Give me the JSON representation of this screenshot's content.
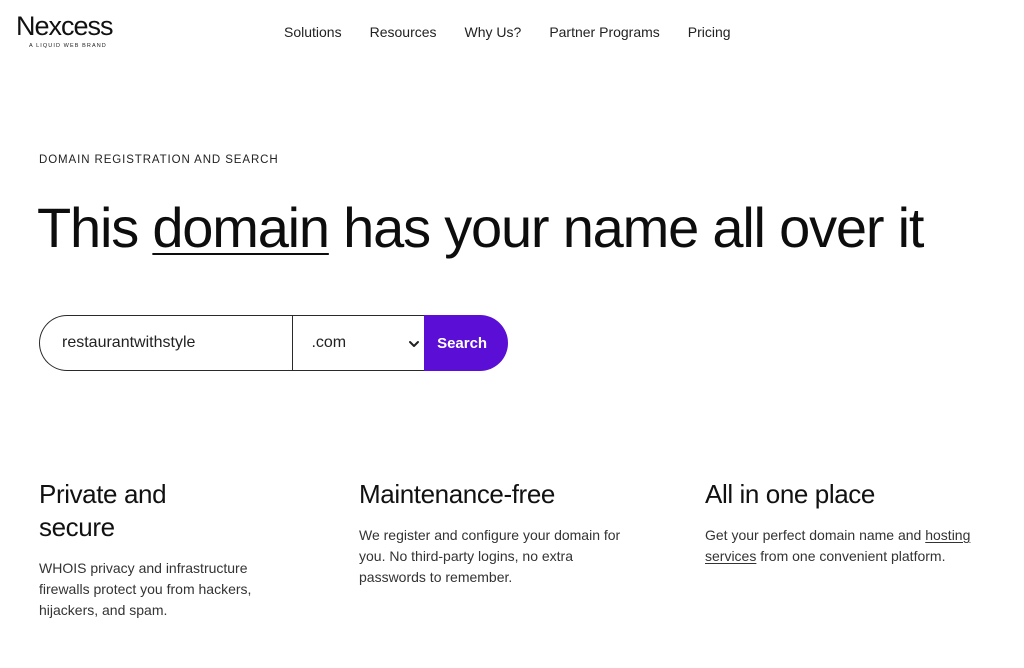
{
  "logo": {
    "wordmark": "Nexcess",
    "tagline": "A LIQUID WEB BRAND"
  },
  "nav": {
    "items": [
      {
        "label": "Solutions"
      },
      {
        "label": "Resources"
      },
      {
        "label": "Why Us?"
      },
      {
        "label": "Partner Programs"
      },
      {
        "label": "Pricing"
      }
    ]
  },
  "hero": {
    "eyebrow": "DOMAIN REGISTRATION AND SEARCH",
    "headline_before": "This ",
    "headline_link": "domain",
    "headline_after": " has your name all over it"
  },
  "search": {
    "input_value": "restaurantwithstyle",
    "tld_selected": ".com",
    "button_label": "Search"
  },
  "features": [
    {
      "title_line1": "Private and",
      "title_line2": "secure",
      "text": "WHOIS privacy and infrastructure firewalls protect you from hackers, hijackers, and spam."
    },
    {
      "title": "Maintenance-free",
      "text": "We register and configure your domain for you. No third-party logins, no extra passwords to remember."
    },
    {
      "title": "All in one place",
      "text_before": "Get your perfect domain name and ",
      "link": "hosting services",
      "text_after": " from one convenient platform."
    }
  ],
  "colors": {
    "accent": "#5b0fd6",
    "text": "#111111",
    "background": "#ffffff"
  }
}
